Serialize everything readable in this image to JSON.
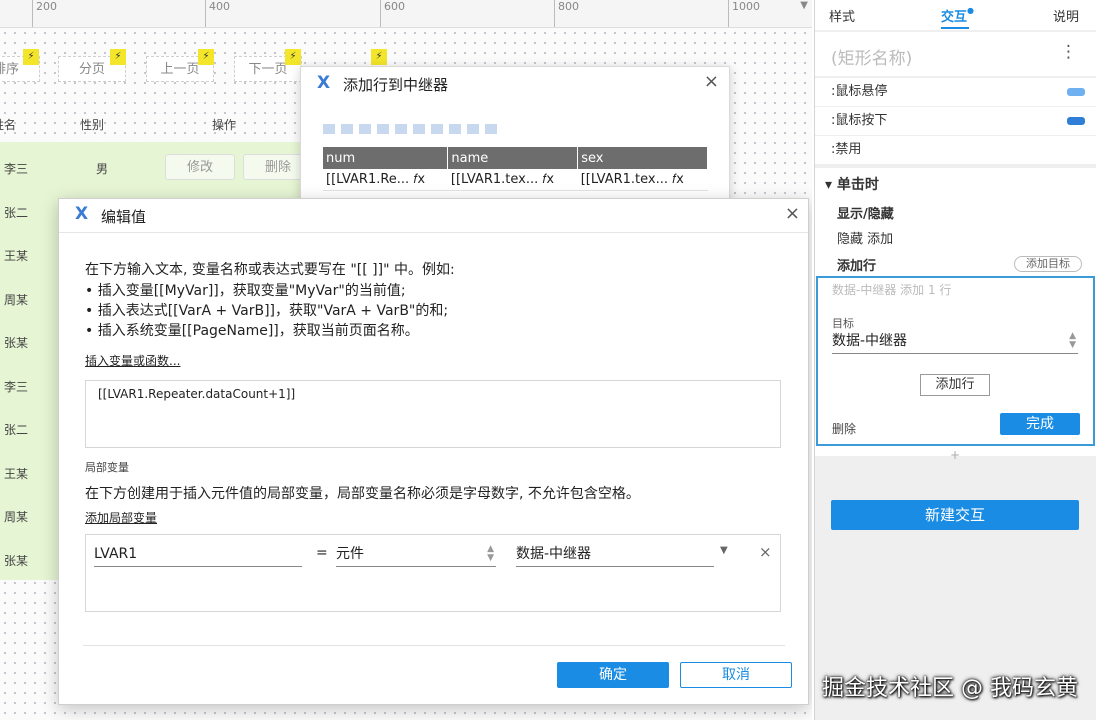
{
  "ruler": {
    "ticks": [
      "200",
      "400",
      "600",
      "800",
      "1000"
    ]
  },
  "page": {
    "buttons": [
      "排序",
      "分页",
      "上一页",
      "下一页"
    ],
    "bolt": "⚡",
    "headers": {
      "name": "姓名",
      "gender": "性别",
      "action": "操作"
    },
    "row1": {
      "name": "李三",
      "gender": "男",
      "edit": "修改",
      "delete": "删除"
    },
    "names": [
      "张二",
      "王某",
      "周某",
      "张某",
      "李三",
      "张二",
      "王某",
      "周某",
      "张某"
    ]
  },
  "repeater_dialog": {
    "logo": "X",
    "title": "添加行到中继器",
    "close": "×",
    "columns": [
      "num",
      "name",
      "sex"
    ],
    "row": [
      "[[LVAR1.Re...",
      "[[LVAR1.tex...",
      "[[LVAR1.tex..."
    ],
    "fx": "𝑓x"
  },
  "edit_dialog": {
    "logo": "X",
    "title": "编辑值",
    "close": "×",
    "intro": "在下方输入文本, 变量名称或表达式要写在 \"[[ ]]\" 中。例如:",
    "example1": "• 插入变量[[MyVar]]，获取变量\"MyVar\"的当前值;",
    "example2": "• 插入表达式[[VarA + VarB]]，获取\"VarA + VarB\"的和;",
    "example3": "• 插入系统变量[[PageName]]，获取当前页面名称。",
    "insert_link": "插入变量或函数...",
    "expression": "[[LVAR1.Repeater.dataCount+1]]",
    "local_label": "局部变量",
    "local_desc": "在下方创建用于插入元件值的局部变量，局部变量名称必须是字母数字, 不允许包含空格。",
    "add_local_link": "添加局部变量",
    "var_name": "LVAR1",
    "equals": "=",
    "var_type": "元件",
    "var_target": "数据-中继器",
    "remove": "×",
    "ok": "确定",
    "cancel": "取消"
  },
  "panel": {
    "tabs": {
      "style": "样式",
      "interact": "交互",
      "notes": "说明"
    },
    "name_placeholder": "(矩形名称)",
    "more": "⋮",
    "events": [
      {
        "label": ":鼠标悬停",
        "color": "#6fb1f0"
      },
      {
        "label": ":鼠标按下",
        "color": "#2f7fd8"
      },
      {
        "label": ":禁用",
        "color": ""
      }
    ],
    "click_header": "▾ 单击时",
    "show_hide": "显示/隐藏",
    "show_hide_detail": "隐藏 添加",
    "add_row": "添加行",
    "add_target": "添加目标",
    "card_summary": "数据-中继器 添加 1 行",
    "target_label": "目标",
    "target_value": "数据-中继器",
    "add_row_btn": "添加行",
    "delete": "删除",
    "done": "完成",
    "plus": "+",
    "new_interaction": "新建交互"
  },
  "watermark": "掘金技术社区 @ 我码玄黄",
  "colors": {
    "accent": "#1a8ce3",
    "green_rows": "#e6f5d4",
    "bolt": "#f2e52a"
  }
}
